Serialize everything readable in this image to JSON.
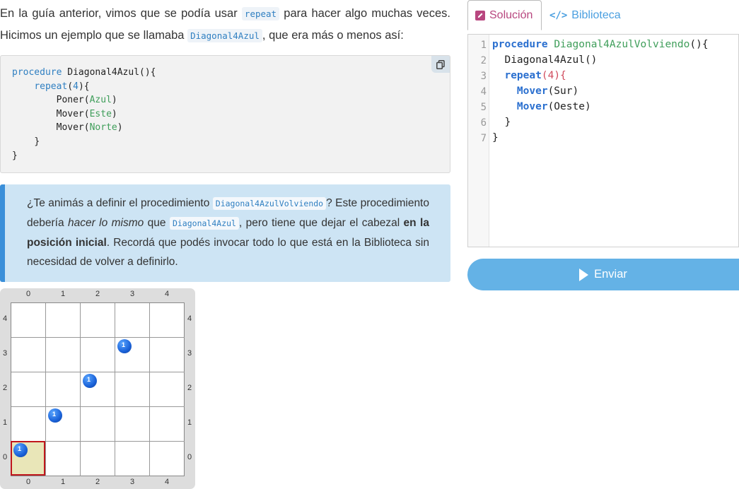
{
  "intro": {
    "t1": "En la guía anterior, vimos que se podía usar",
    "c1": "repeat",
    "t2": "para hacer algo muchas veces. Hicimos un ejemplo que se llamaba",
    "c2": "Diagonal4Azul",
    "t3": ", que era más o menos así:"
  },
  "example": {
    "lines": [
      {
        "kw": "procedure",
        "rest": " Diagonal4Azul(){"
      },
      {
        "indent": "    ",
        "kw": "repeat",
        "rest": "(",
        "num": "4",
        "end": "){"
      },
      {
        "indent": "        ",
        "fn": "Poner",
        "arg": "Azul"
      },
      {
        "indent": "        ",
        "fn": "Mover",
        "arg": "Este"
      },
      {
        "indent": "        ",
        "fn": "Mover",
        "arg": "Norte"
      },
      {
        "indent": "    ",
        "fn": "}"
      },
      {
        "indent": "",
        "fn": "}"
      }
    ]
  },
  "info": {
    "a": "¿Te animás a definir el procedimiento",
    "c1": "Diagonal4AzulVolviendo",
    "b": "? Este procedimiento debería",
    "em": "hacer lo mismo",
    "c": "que",
    "c2": "Diagonal4Azul",
    "d": ", pero tiene que dejar el cabezal",
    "strong": "en la posición inicial",
    "e": ". Recordá que podés invocar todo lo que está en la Biblioteca sin necesidad de volver a definirlo."
  },
  "board": {
    "cols": [
      "0",
      "1",
      "2",
      "3",
      "4"
    ],
    "rows": [
      "4",
      "3",
      "2",
      "1",
      "0"
    ],
    "ball_count": "1",
    "head": {
      "x": 0,
      "y": 0
    },
    "balls": [
      {
        "x": 0,
        "y": 0
      },
      {
        "x": 1,
        "y": 1
      },
      {
        "x": 2,
        "y": 2
      },
      {
        "x": 3,
        "y": 3
      }
    ]
  },
  "tabs": {
    "solucion": "Solución",
    "biblioteca": "Biblioteca"
  },
  "editor": {
    "line_numbers": [
      "1",
      "2",
      "3",
      "4",
      "5",
      "6",
      "7"
    ],
    "l1_kw": "procedure",
    "l1_name": "Diagonal4AzulVolviendo",
    "l1_end": "(){",
    "l2": "  Diagonal4Azul()",
    "l3_kw": "repeat",
    "l3_a": "(",
    "l3_num": "4",
    "l3_b": "){",
    "l4_fn": "Mover",
    "l4_arg": "(Sur)",
    "l5_fn": "Mover",
    "l5_arg": "(Oeste)",
    "l6": "  }",
    "l7": "}"
  },
  "submit": {
    "label": "Enviar"
  },
  "colors": {
    "accent": "#64b2e6",
    "solution_tab": "#b8477f",
    "head_border": "#c0171c",
    "ball": "#1a62d9"
  }
}
